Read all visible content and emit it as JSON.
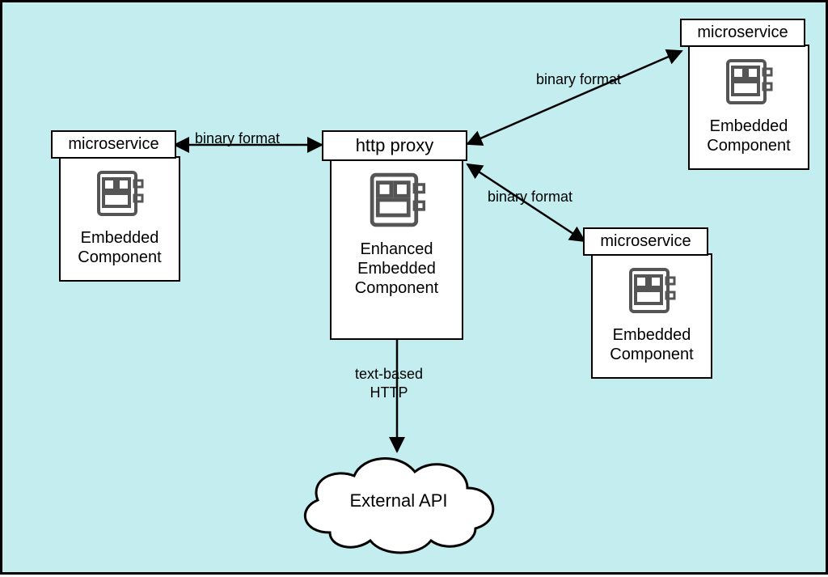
{
  "nodes": {
    "left_microservice": {
      "title": "microservice",
      "component_label": "Embedded\nComponent"
    },
    "proxy": {
      "title": "http proxy",
      "component_label": "Enhanced\nEmbedded\nComponent"
    },
    "top_microservice": {
      "title": "microservice",
      "component_label": "Embedded\nComponent"
    },
    "right_microservice": {
      "title": "microservice",
      "component_label": "Embedded\nComponent"
    },
    "external_api": {
      "label": "External API"
    }
  },
  "edges": {
    "left_to_proxy": "binary format",
    "proxy_to_top": "binary format",
    "proxy_to_right": "binary format",
    "proxy_to_api": "text-based\nHTTP"
  }
}
